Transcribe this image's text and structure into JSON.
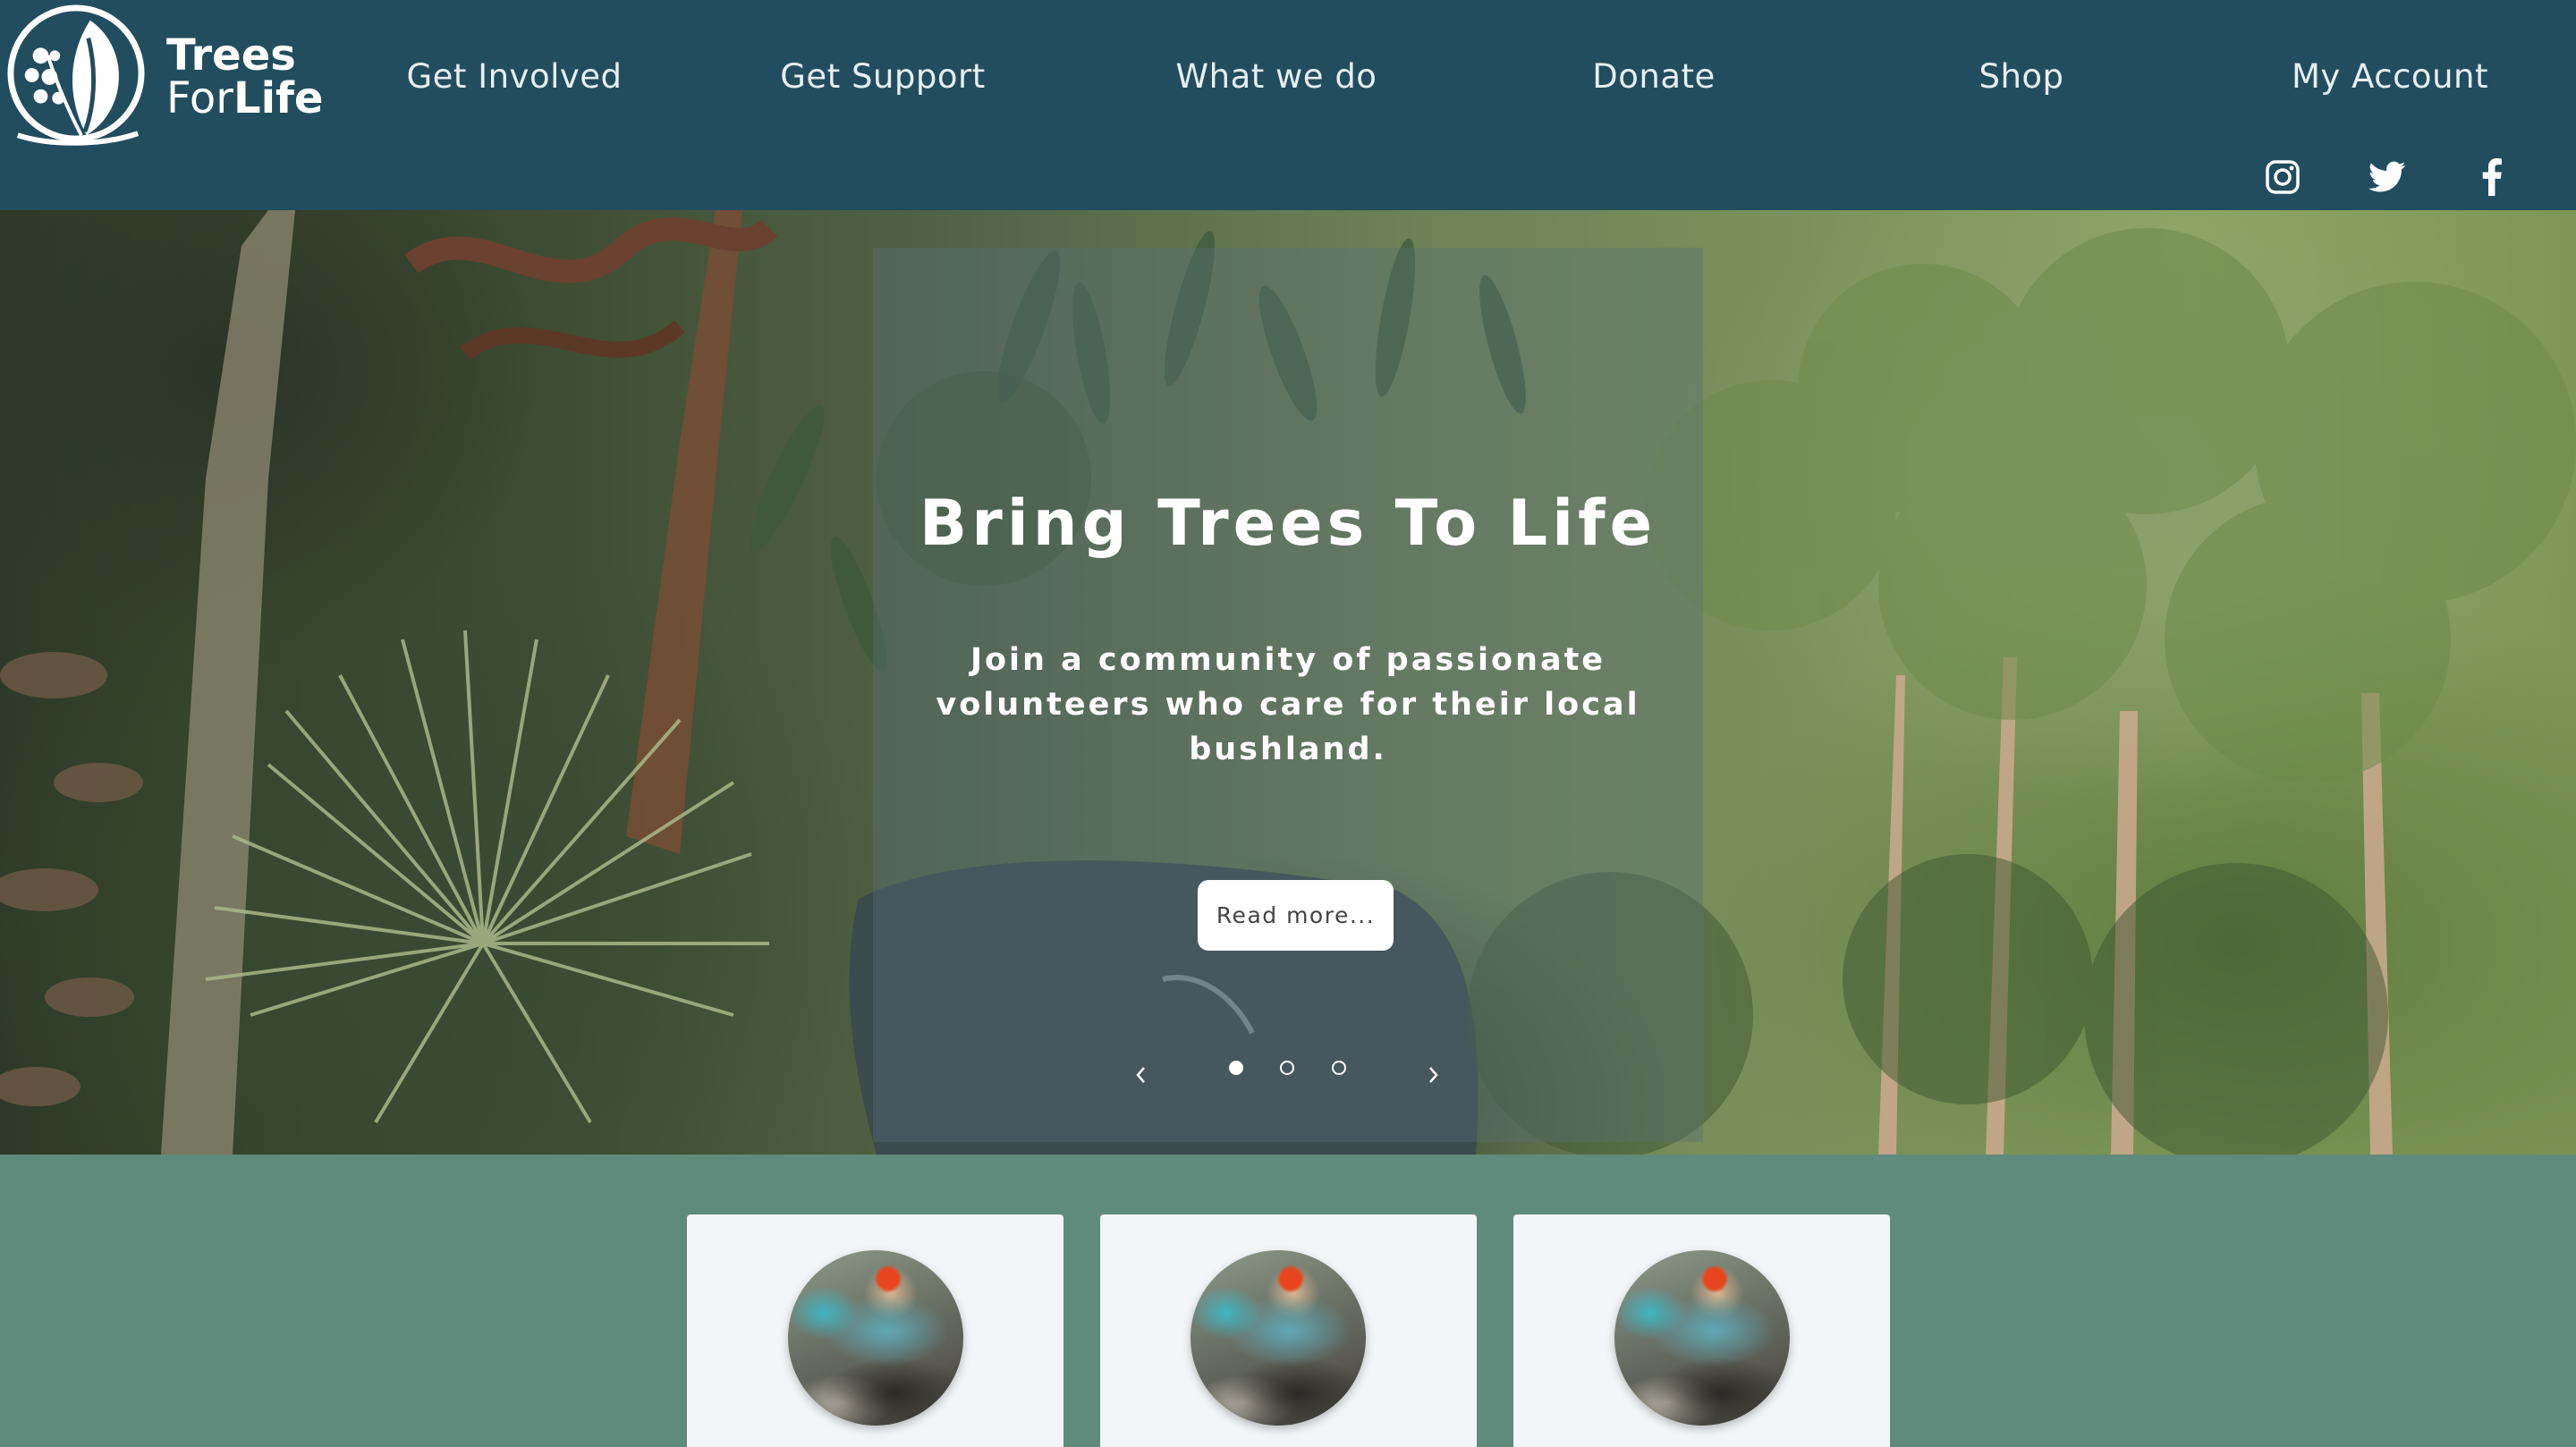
{
  "brand": {
    "line1": "Trees",
    "line2_light": "For",
    "line2_bold": "Life"
  },
  "nav": [
    {
      "label": "Get Involved"
    },
    {
      "label": "Get Support"
    },
    {
      "label": "What we do"
    },
    {
      "label": "Donate"
    },
    {
      "label": "Shop"
    },
    {
      "label": "My Account"
    }
  ],
  "social": [
    {
      "icon": "instagram-icon"
    },
    {
      "icon": "twitter-icon"
    },
    {
      "icon": "facebook-icon"
    }
  ],
  "hero": {
    "title": "Bring Trees To Life",
    "subtitle": "Join a community of passionate volunteers who care for their local bushland.",
    "button_label": "Read more...",
    "slides_count": 3,
    "active_slide": 1,
    "prev_icon": "chevron-left-icon",
    "next_icon": "chevron-right-icon"
  },
  "cards": [
    {
      "image": "volunteer-photo"
    },
    {
      "image": "volunteer-photo"
    },
    {
      "image": "volunteer-photo"
    }
  ],
  "colors": {
    "header_bg": "#224d5f",
    "section_bg": "#5f8b7c",
    "card_bg": "#f3f6f8",
    "text_light": "#ffffff"
  }
}
